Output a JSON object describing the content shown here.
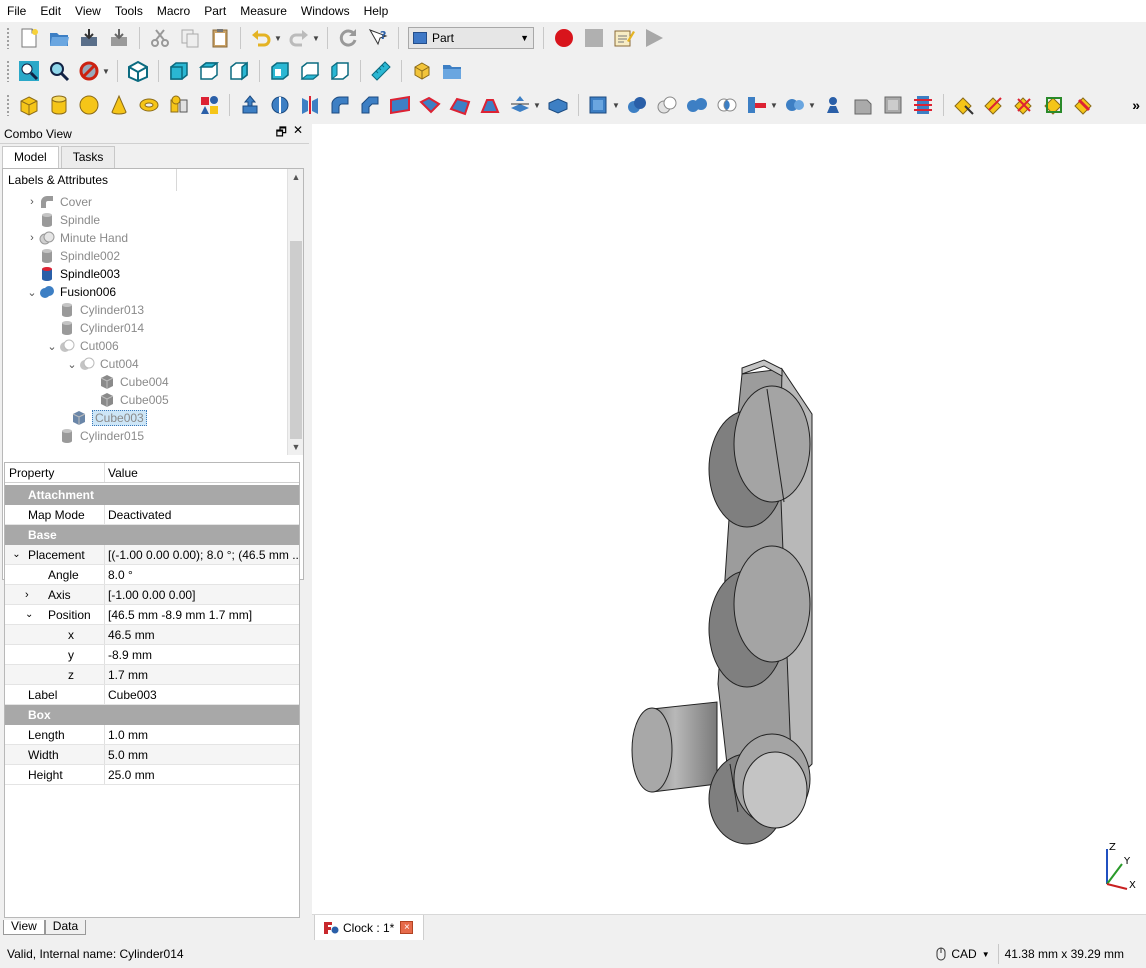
{
  "menu": [
    "File",
    "Edit",
    "View",
    "Tools",
    "Macro",
    "Part",
    "Measure",
    "Windows",
    "Help"
  ],
  "toolbar": {
    "workbench": "Part",
    "more": "»"
  },
  "combo_view": {
    "title": "Combo View",
    "tabs": [
      "Model",
      "Tasks"
    ],
    "tree_header": "Labels & Attributes",
    "tree": [
      {
        "label": "Cover",
        "expand": "›",
        "visible": false
      },
      {
        "label": "Spindle",
        "expand": "",
        "visible": false
      },
      {
        "label": "Minute Hand",
        "expand": "›",
        "visible": false
      },
      {
        "label": "Spindle002",
        "expand": "",
        "visible": false
      },
      {
        "label": "Spindle003",
        "expand": "",
        "visible": true
      },
      {
        "label": "Fusion006",
        "expand": "⌄",
        "visible": true
      },
      {
        "label": "Cylinder013",
        "expand": "",
        "visible": false
      },
      {
        "label": "Cylinder014",
        "expand": "",
        "visible": false
      },
      {
        "label": "Cut006",
        "expand": "⌄",
        "visible": false
      },
      {
        "label": "Cut004",
        "expand": "⌄",
        "visible": false
      },
      {
        "label": "Cube004",
        "expand": "",
        "visible": false
      },
      {
        "label": "Cube005",
        "expand": "",
        "visible": false
      },
      {
        "label": "Cube003",
        "expand": "",
        "visible": false
      },
      {
        "label": "Cylinder015",
        "expand": "",
        "visible": false
      }
    ],
    "property_header": {
      "key": "Property",
      "value": "Value"
    },
    "properties": [
      {
        "type": "group",
        "key": "Attachment"
      },
      {
        "type": "row",
        "key": "Map Mode",
        "value": "Deactivated",
        "indent": 0
      },
      {
        "type": "group",
        "key": "Base"
      },
      {
        "type": "row",
        "key": "Placement",
        "value": "[(-1.00 0.00 0.00); 8.0 °; (46.5 mm ...",
        "indent": 0,
        "expand": "⌄"
      },
      {
        "type": "row",
        "key": "Angle",
        "value": "8.0 °",
        "indent": 1
      },
      {
        "type": "row",
        "key": "Axis",
        "value": "[-1.00 0.00 0.00]",
        "indent": 1,
        "expand": "›"
      },
      {
        "type": "row",
        "key": "Position",
        "value": "[46.5 mm  -8.9 mm  1.7 mm]",
        "indent": 1,
        "expand": "⌄"
      },
      {
        "type": "row",
        "key": "x",
        "value": "46.5 mm",
        "indent": 2
      },
      {
        "type": "row",
        "key": "y",
        "value": "-8.9 mm",
        "indent": 2
      },
      {
        "type": "row",
        "key": "z",
        "value": "1.7 mm",
        "indent": 2
      },
      {
        "type": "row",
        "key": "Label",
        "value": "Cube003",
        "indent": 0
      },
      {
        "type": "group",
        "key": "Box"
      },
      {
        "type": "row",
        "key": "Length",
        "value": "1.0 mm",
        "indent": 0
      },
      {
        "type": "row",
        "key": "Width",
        "value": "5.0 mm",
        "indent": 0
      },
      {
        "type": "row",
        "key": "Height",
        "value": "25.0 mm",
        "indent": 0
      }
    ],
    "bottom_tabs": [
      "View",
      "Data"
    ]
  },
  "document_tab": {
    "label": "Clock : 1*",
    "close": "×"
  },
  "axis_labels": {
    "z": "Z",
    "y": "Y",
    "x": "X"
  },
  "status": {
    "message": "Valid, Internal name: Cylinder014",
    "nav_style": "CAD",
    "dimensions": "41.38 mm x 39.29 mm"
  }
}
